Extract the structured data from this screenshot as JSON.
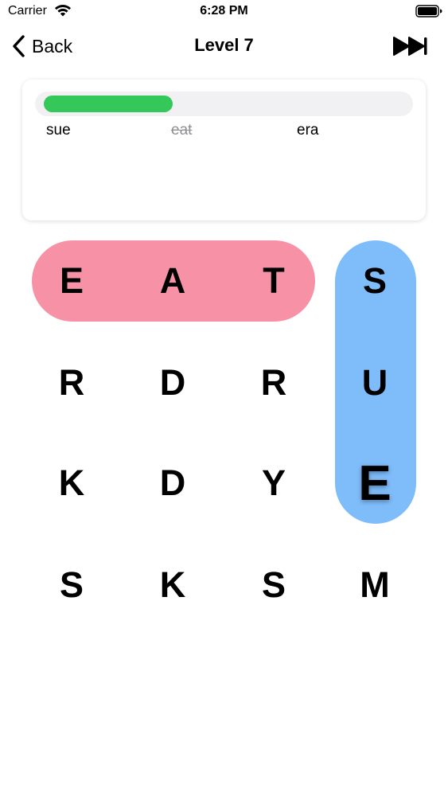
{
  "status_bar": {
    "carrier": "Carrier",
    "time": "6:28 PM",
    "wifi_icon": "wifi-icon",
    "battery_icon": "battery-icon"
  },
  "nav": {
    "back_label": "Back",
    "back_icon": "chevron-left-icon",
    "title": "Level 7",
    "skip_icon": "fast-forward-icon"
  },
  "progress": {
    "fraction": 0.333,
    "color": "#34c759",
    "track_color": "#f1f1f3"
  },
  "words": [
    {
      "text": "sue",
      "found": false
    },
    {
      "text": "eat",
      "found": true
    },
    {
      "text": "era",
      "found": false
    }
  ],
  "grid": {
    "rows": [
      [
        "E",
        "A",
        "T",
        "S"
      ],
      [
        "R",
        "D",
        "R",
        "U"
      ],
      [
        "K",
        "D",
        "Y",
        "E"
      ],
      [
        "S",
        "K",
        "S",
        "M"
      ]
    ],
    "active_cell": {
      "row": 2,
      "col": 3
    },
    "highlights": [
      {
        "word": "EAT",
        "direction": "horizontal",
        "color": "#f792a6"
      },
      {
        "word": "SUE",
        "direction": "vertical",
        "color": "#7fbcfa"
      }
    ]
  }
}
